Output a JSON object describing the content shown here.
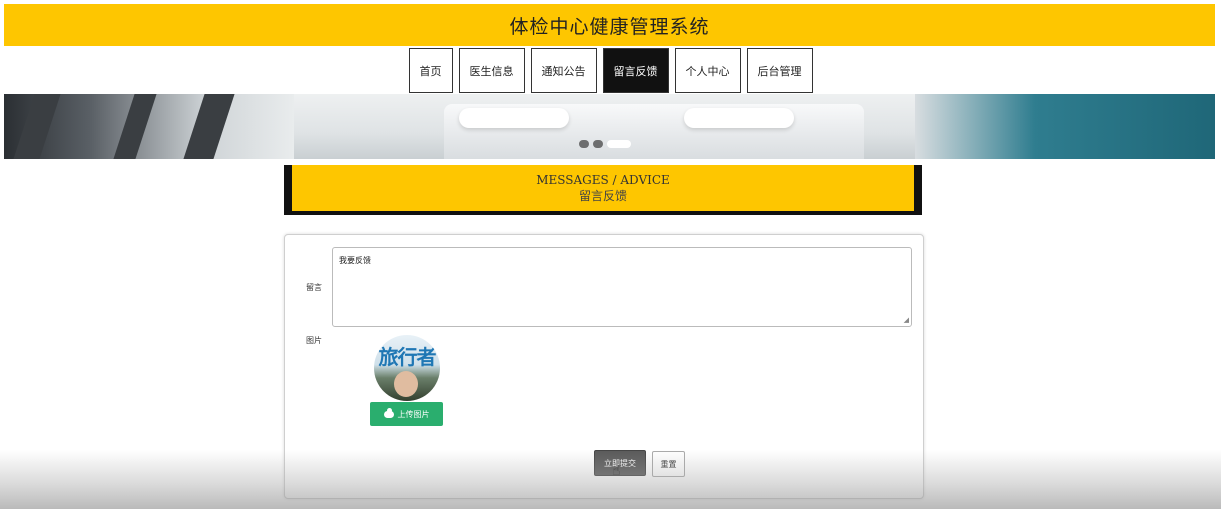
{
  "header": {
    "title": "体检中心健康管理系统"
  },
  "nav": {
    "items": [
      {
        "label": "首页"
      },
      {
        "label": "医生信息"
      },
      {
        "label": "通知公告"
      },
      {
        "label": "留言反馈"
      },
      {
        "label": "个人中心"
      },
      {
        "label": "后台管理"
      }
    ],
    "active": "留言反馈"
  },
  "section": {
    "title_en": "MESSAGES / ADVICE",
    "title_cn": "留言反馈"
  },
  "form": {
    "message_label": "留言",
    "message_value": "我要反馈",
    "image_label": "图片",
    "upload_label": "上传图片",
    "submit_label": "立即提交",
    "reset_label": "重置"
  },
  "avatar": {
    "text": "旅行者"
  },
  "colors": {
    "brand": "#fec600",
    "nav_active": "#111111",
    "upload": "#2aae6e",
    "submit": "#5a5a5a"
  }
}
